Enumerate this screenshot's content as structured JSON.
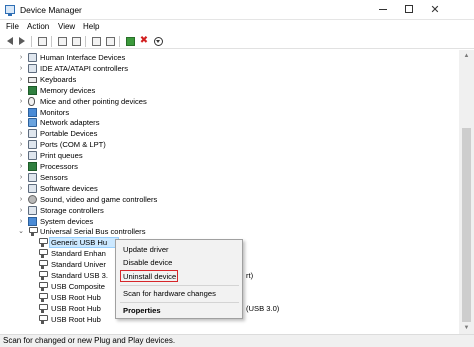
{
  "window": {
    "title": "Device Manager",
    "minimize_icon": "minimize-icon",
    "maximize_icon": "maximize-icon",
    "close_glyph": "✕"
  },
  "menu": [
    "File",
    "Action",
    "View",
    "Help"
  ],
  "toolbar_icons": [
    "back-icon",
    "forward-icon",
    "properties-icon",
    "help-icon",
    "update-driver-icon",
    "monitor-icon",
    "enable-device-icon",
    "uninstall-icon",
    "update-icon"
  ],
  "tree": [
    {
      "label": "Human Interface Devices",
      "icon": "hid-icon",
      "expanded": false
    },
    {
      "label": "IDE ATA/ATAPI controllers",
      "icon": "ide-icon",
      "expanded": false
    },
    {
      "label": "Keyboards",
      "icon": "keyboard-icon",
      "expanded": false
    },
    {
      "label": "Memory devices",
      "icon": "memory-icon",
      "expanded": false
    },
    {
      "label": "Mice and other pointing devices",
      "icon": "mouse-icon",
      "expanded": false
    },
    {
      "label": "Monitors",
      "icon": "monitor-icon",
      "expanded": false
    },
    {
      "label": "Network adapters",
      "icon": "network-icon",
      "expanded": false
    },
    {
      "label": "Portable Devices",
      "icon": "portable-icon",
      "expanded": false
    },
    {
      "label": "Ports (COM & LPT)",
      "icon": "port-icon",
      "expanded": false
    },
    {
      "label": "Print queues",
      "icon": "printer-icon",
      "expanded": false
    },
    {
      "label": "Processors",
      "icon": "processor-icon",
      "expanded": false
    },
    {
      "label": "Sensors",
      "icon": "sensor-icon",
      "expanded": false
    },
    {
      "label": "Software devices",
      "icon": "software-icon",
      "expanded": false
    },
    {
      "label": "Sound, video and game controllers",
      "icon": "sound-icon",
      "expanded": false
    },
    {
      "label": "Storage controllers",
      "icon": "storage-icon",
      "expanded": false
    },
    {
      "label": "System devices",
      "icon": "system-icon",
      "expanded": false
    },
    {
      "label": "Universal Serial Bus controllers",
      "icon": "usb-controller-icon",
      "expanded": true
    }
  ],
  "usb_children": [
    {
      "label": "Generic USB Hu",
      "selected": true
    },
    {
      "label": "Standard Enhan"
    },
    {
      "label": "Standard Univer"
    },
    {
      "label": "Standard USB 3."
    },
    {
      "label": "USB Composite"
    },
    {
      "label": "USB Root Hub"
    },
    {
      "label": "USB Root Hub"
    },
    {
      "label": "USB Root Hub"
    }
  ],
  "usb_children_tails": [
    "rt)",
    "(USB 3.0)"
  ],
  "context_menu": {
    "items": [
      "Update driver",
      "Disable device",
      "Uninstall device",
      "Scan for hardware changes",
      "Properties"
    ],
    "highlighted": "Uninstall device",
    "highlight_color": "#d7262a"
  },
  "status": "Scan for changed or new Plug and Play devices.",
  "colors": {
    "selection": "#cce8ff",
    "menu_bg": "#f2f2f2"
  }
}
